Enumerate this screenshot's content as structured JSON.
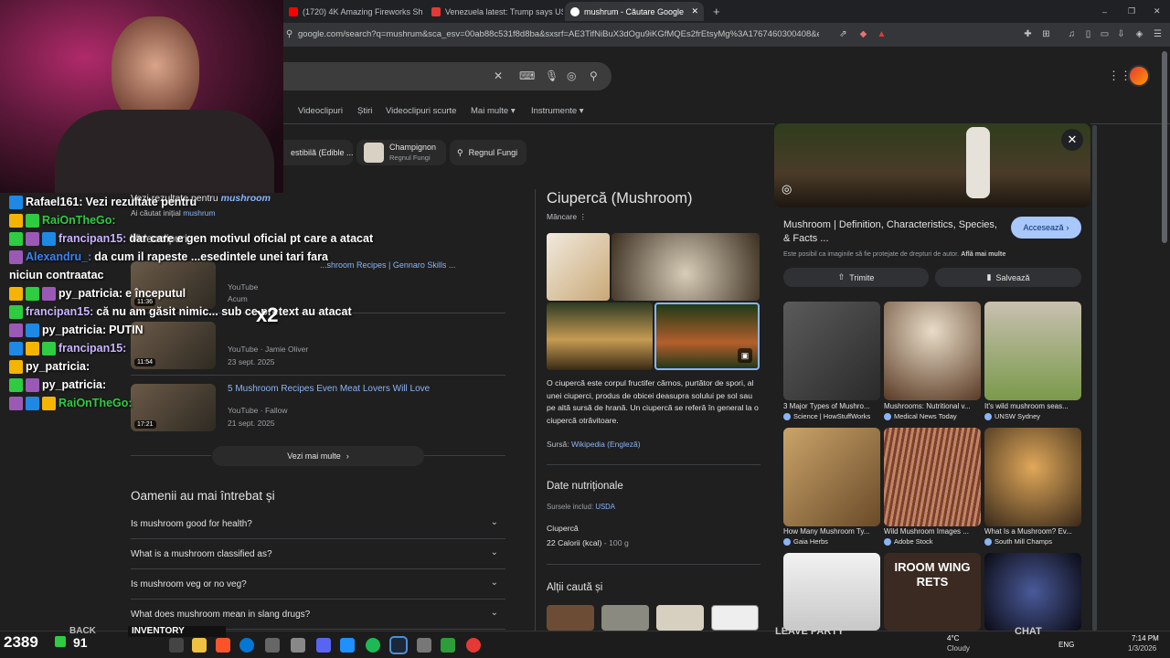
{
  "browser": {
    "tabs": [
      {
        "label": "(1720) 4K Amazing Fireworks Show w...",
        "color": "#ff0000"
      },
      {
        "label": "Venezuela latest: Trump says US will...",
        "color": "#e53935"
      },
      {
        "label": "mushrum - Căutare Google",
        "color": "#ffffff"
      }
    ],
    "url": "google.com/search?q=mushrum&sca_esv=00ab88c531f8d8ba&sxsrf=AE3TifNiBuX3dOgu9iKGfMQEs2frEtsyMg%3A1767460300408&ei=zE1ZaaPHG..."
  },
  "search": {
    "tabs": [
      "Videoclipuri",
      "Știri",
      "Videoclipuri scurte",
      "Mai multe",
      "Instrumente"
    ],
    "chips": [
      {
        "label": "estibilă (Edible ..."
      },
      {
        "label": "Champignon",
        "sub": "Regnul Fungi"
      },
      {
        "label": "Regnul Fungi"
      }
    ],
    "correction": {
      "prefix": "Vezi rezultate pentru",
      "term": "mushroom",
      "orig_prefix": "Ai căutat inițial",
      "orig_term": "mushrum"
    },
    "videos_heading": "Videoclipuri",
    "videos": [
      {
        "title": "...shroom Recipes | Gennaro Skills ...",
        "source": "YouTube",
        "date": "Acum",
        "dur": "11:36"
      },
      {
        "title": "",
        "source": "YouTube · Jamie Oliver",
        "date": "23 sept. 2025",
        "dur": "11:54"
      },
      {
        "title": "5 Mushroom Recipes Even Meat Lovers Will Love",
        "source": "YouTube · Fallow",
        "date": "21 sept. 2025",
        "dur": "17:21"
      }
    ],
    "more_videos": "Vezi mai multe",
    "paa_heading": "Oamenii au mai întrebat și",
    "paa": [
      "Is mushroom good for health?",
      "What is a mushroom classified as?",
      "Is mushroom veg or no veg?",
      "What does mushroom mean in slang drugs?"
    ]
  },
  "knowledge": {
    "title": "Ciupercă (Mushroom)",
    "subtitle": "Mâncare",
    "description": "O ciupercă este corpul fructifer cărnos, purtător de spori, al unei ciuperci, produs de obicei deasupra solului pe sol sau pe altă sursă de hrană. Un ciupercă se referă în general la o ciupercă otrăvitoare.",
    "source_label": "Sursă:",
    "source_link": "Wikipedia (Engleză)",
    "nutrition_heading": "Date nutriționale",
    "nutrition_src_label": "Sursele includ:",
    "nutrition_src": "USDA",
    "nutrition_item": "Ciupercă",
    "calories": "22 Calorii (kcal)",
    "portion": "- 100 g",
    "also_search": "Alții caută și"
  },
  "panel": {
    "title": "Mushroom | Definition, Characteristics, Species, & Facts ...",
    "visit": "Accesează",
    "copyright": "Este posibil ca imaginile să fie protejate de drepturi de autor.",
    "learn_more": "Află mai multe",
    "share": "Trimite",
    "save": "Salvează",
    "images": [
      {
        "caption": "3 Major Types of Mushro...",
        "source": "Science | HowStuffWorks"
      },
      {
        "caption": "Mushrooms: Nutritional v...",
        "source": "Medical News Today"
      },
      {
        "caption": "It's wild mushroom seas...",
        "source": "UNSW Sydney"
      },
      {
        "caption": "How Many Mushroom Ty...",
        "source": "Gaia Herbs"
      },
      {
        "caption": "Wild Mushroom Images ...",
        "source": "Adobe Stock"
      },
      {
        "caption": "What Is a Mushroom? Ev...",
        "source": "South Mill Champs"
      }
    ],
    "room_text": "IROOM WING RETS"
  },
  "chat": [
    {
      "user": "Rafael161:",
      "color": "#ffffff",
      "msg": "Vezi rezultate pentru"
    },
    {
      "user": "RaiOnTheGo:",
      "color": "#2ecc40",
      "msg": ""
    },
    {
      "user": "francipan15:",
      "color": "#c9b3ff",
      "msg": "dar care e gen motivul oficial pt care a atacat"
    },
    {
      "user": "Alexandru_:",
      "color": "#3b82f6",
      "msg": "da cum il rapeste ...esedintele unei tari fara"
    },
    {
      "user": "",
      "color": "#ffffff",
      "msg": "niciun contraatac"
    },
    {
      "user": "py_patricia:",
      "color": "#ffffff",
      "msg": "e începutul"
    },
    {
      "user": "francipan15:",
      "color": "#c9b3ff",
      "msg": "că nu am găsit nimic... sub ce pretext au atacat"
    },
    {
      "user": "py_patricia:",
      "color": "#ffffff",
      "msg": "PUTIN"
    },
    {
      "user": "francipan15:",
      "color": "#c9b3ff",
      "msg": ""
    },
    {
      "user": "py_patricia:",
      "color": "#ffffff",
      "msg": ""
    },
    {
      "user": "py_patricia:",
      "color": "#ffffff",
      "msg": ""
    },
    {
      "user": "RaiOnTheGo:",
      "color": "#2ecc40",
      "msg": ""
    }
  ],
  "overlay": {
    "multiplier": "x2",
    "viewers": "2389",
    "followers": "91"
  },
  "taskbar": {
    "back": "BACK",
    "inventory": "INVENTORY",
    "leave_party": "LEAVE PARTY",
    "chat": "CHAT",
    "weather_temp": "4°C",
    "weather_desc": "Cloudy",
    "lang": "ENG",
    "time": "7:14 PM",
    "date": "1/3/2026"
  }
}
